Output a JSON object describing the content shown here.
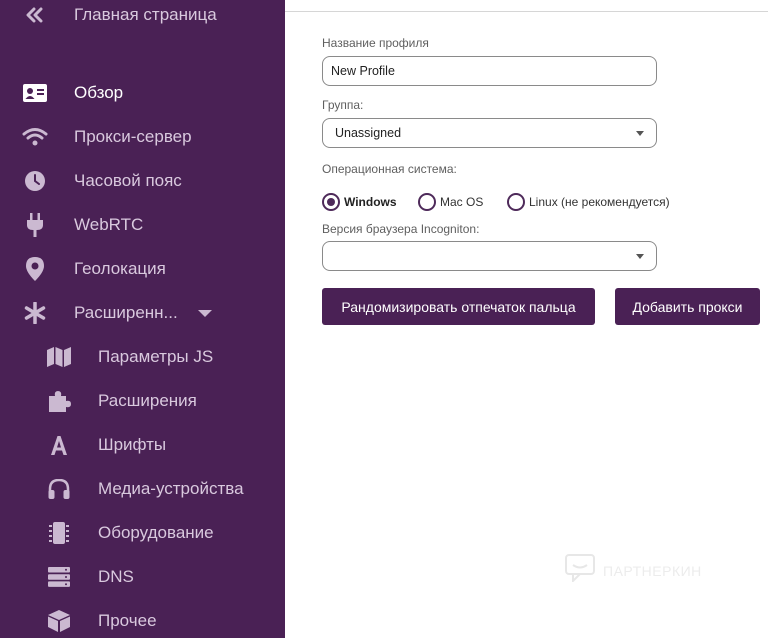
{
  "sidebar": {
    "back": {
      "label": "Главная страница",
      "icon": "double-chevron-left-icon"
    },
    "items": [
      {
        "label": "Обзор",
        "icon": "id-card-icon",
        "active": true
      },
      {
        "label": "Прокси-сервер",
        "icon": "wifi-icon"
      },
      {
        "label": "Часовой пояс",
        "icon": "clock-icon"
      },
      {
        "label": "WebRTC",
        "icon": "plug-icon"
      },
      {
        "label": "Геолокация",
        "icon": "location-pin-icon"
      },
      {
        "label": "Расширенн...",
        "icon": "asterisk-icon",
        "expandable": true
      }
    ],
    "subitems": [
      {
        "label": "Параметры JS",
        "icon": "map-icon"
      },
      {
        "label": "Расширения",
        "icon": "puzzle-icon"
      },
      {
        "label": "Шрифты",
        "icon": "font-icon"
      },
      {
        "label": "Медиа-устройства",
        "icon": "headphones-icon"
      },
      {
        "label": "Оборудование",
        "icon": "chip-icon"
      },
      {
        "label": "DNS",
        "icon": "server-icon"
      },
      {
        "label": "Прочее",
        "icon": "box-icon"
      }
    ]
  },
  "form": {
    "profile_name": {
      "label": "Название профиля",
      "value": "New Profile"
    },
    "group": {
      "label": "Группа:",
      "value": "Unassigned"
    },
    "os": {
      "label": "Операционная система:",
      "options": [
        {
          "label": "Windows",
          "selected": true
        },
        {
          "label": "Mac OS",
          "selected": false
        },
        {
          "label": "Linux (не рекомендуется)",
          "selected": false
        }
      ]
    },
    "browser_version": {
      "label": "Версия браузера Incogniton:",
      "value": ""
    }
  },
  "buttons": {
    "randomize": "Рандомизировать отпечаток пальца",
    "add_proxy": "Добавить прокси"
  },
  "watermark": {
    "text": "ПАРТНЕРКИН",
    "icon": "chat-bubble-icon"
  },
  "colors": {
    "sidebar_bg": "#4a2155",
    "accent": "#4a2155"
  }
}
